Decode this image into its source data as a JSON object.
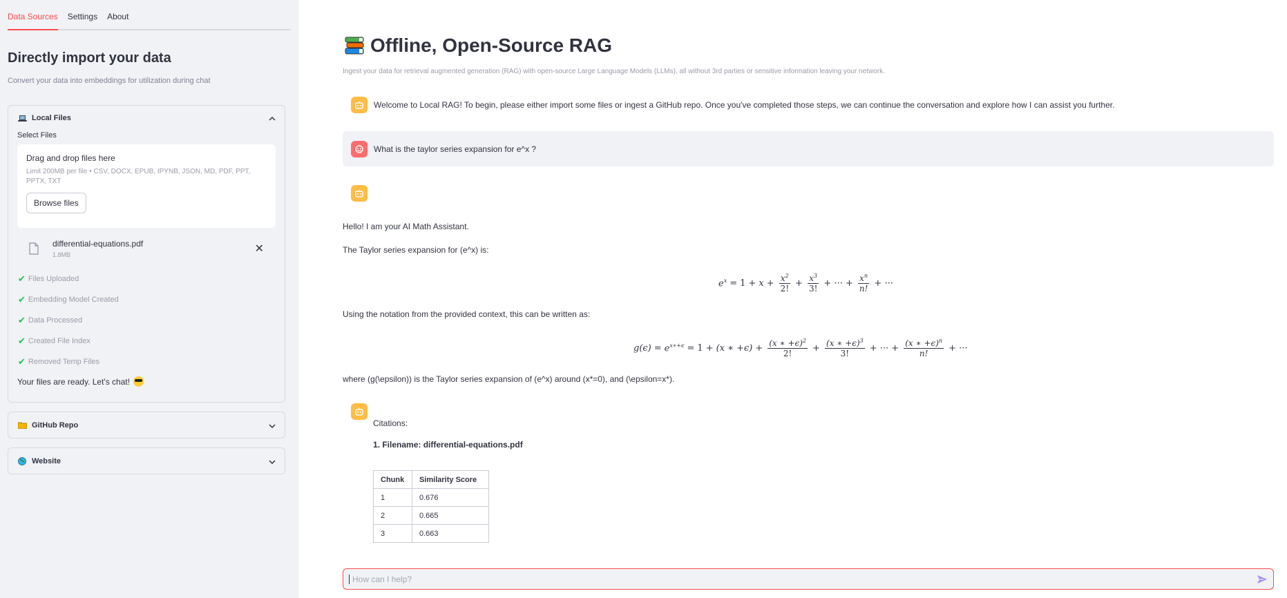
{
  "sidebar": {
    "tabs": [
      {
        "label": "Data Sources",
        "active": true
      },
      {
        "label": "Settings",
        "active": false
      },
      {
        "label": "About",
        "active": false
      }
    ],
    "title": "Directly import your data",
    "caption": "Convert your data into embeddings for utilization during chat",
    "local_files": {
      "header": "Local Files",
      "icon": "laptop-icon",
      "select_label": "Select Files",
      "dropzone_title": "Drag and drop files here",
      "dropzone_limit": "Limit 200MB per file • CSV, DOCX, EPUB, IPYNB, JSON, MD, PDF, PPT, PPTX, TXT",
      "browse_label": "Browse files",
      "file": {
        "name": "differential-equations.pdf",
        "size": "1.8MB"
      },
      "statuses": [
        "Files Uploaded",
        "Embedding Model Created",
        "Data Processed",
        "Created File Index",
        "Removed Temp Files"
      ],
      "ready": "Your files are ready. Let's chat!"
    },
    "github": {
      "header": "GitHub Repo",
      "icon": "folder-icon"
    },
    "website": {
      "header": "Website",
      "icon": "globe-icon"
    }
  },
  "main": {
    "title": "Offline, Open-Source RAG",
    "subtitle": "Ingest your data for retrieval augmented generation (RAG) with open-source Large Language Models (LLMs), all without 3rd parties or sensitive information leaving your network.",
    "welcome": "Welcome to Local RAG! To begin, please either import some files or ingest a GitHub repo. Once you've completed those steps, we can continue the conversation and explore how I can assist you further.",
    "user_question": "What is the taylor series expansion for e^x ?",
    "answer": {
      "greeting": "Hello! I am your AI Math Assistant.",
      "intro": "The Taylor series expansion for (e^x) is:",
      "notation": "Using the notation from the provided context, this can be written as:",
      "where": "where (g(\\epsilon)) is the Taylor series expansion of (e^x) around (x*=0), and (\\epsilon=x*)."
    },
    "citations": {
      "label": "Citations:",
      "file": "1. Filename: differential-equations.pdf",
      "headers": [
        "Chunk",
        "Similarity Score"
      ],
      "rows": [
        [
          "1",
          "0.676"
        ],
        [
          "2",
          "0.665"
        ],
        [
          "3",
          "0.663"
        ]
      ]
    },
    "input": {
      "placeholder": "How can I help?"
    }
  },
  "colors": {
    "accent": "#ff4b4b",
    "bot_avatar": "#ffbd45",
    "user_avatar": "#ff6c6c",
    "check": "#21c354"
  }
}
